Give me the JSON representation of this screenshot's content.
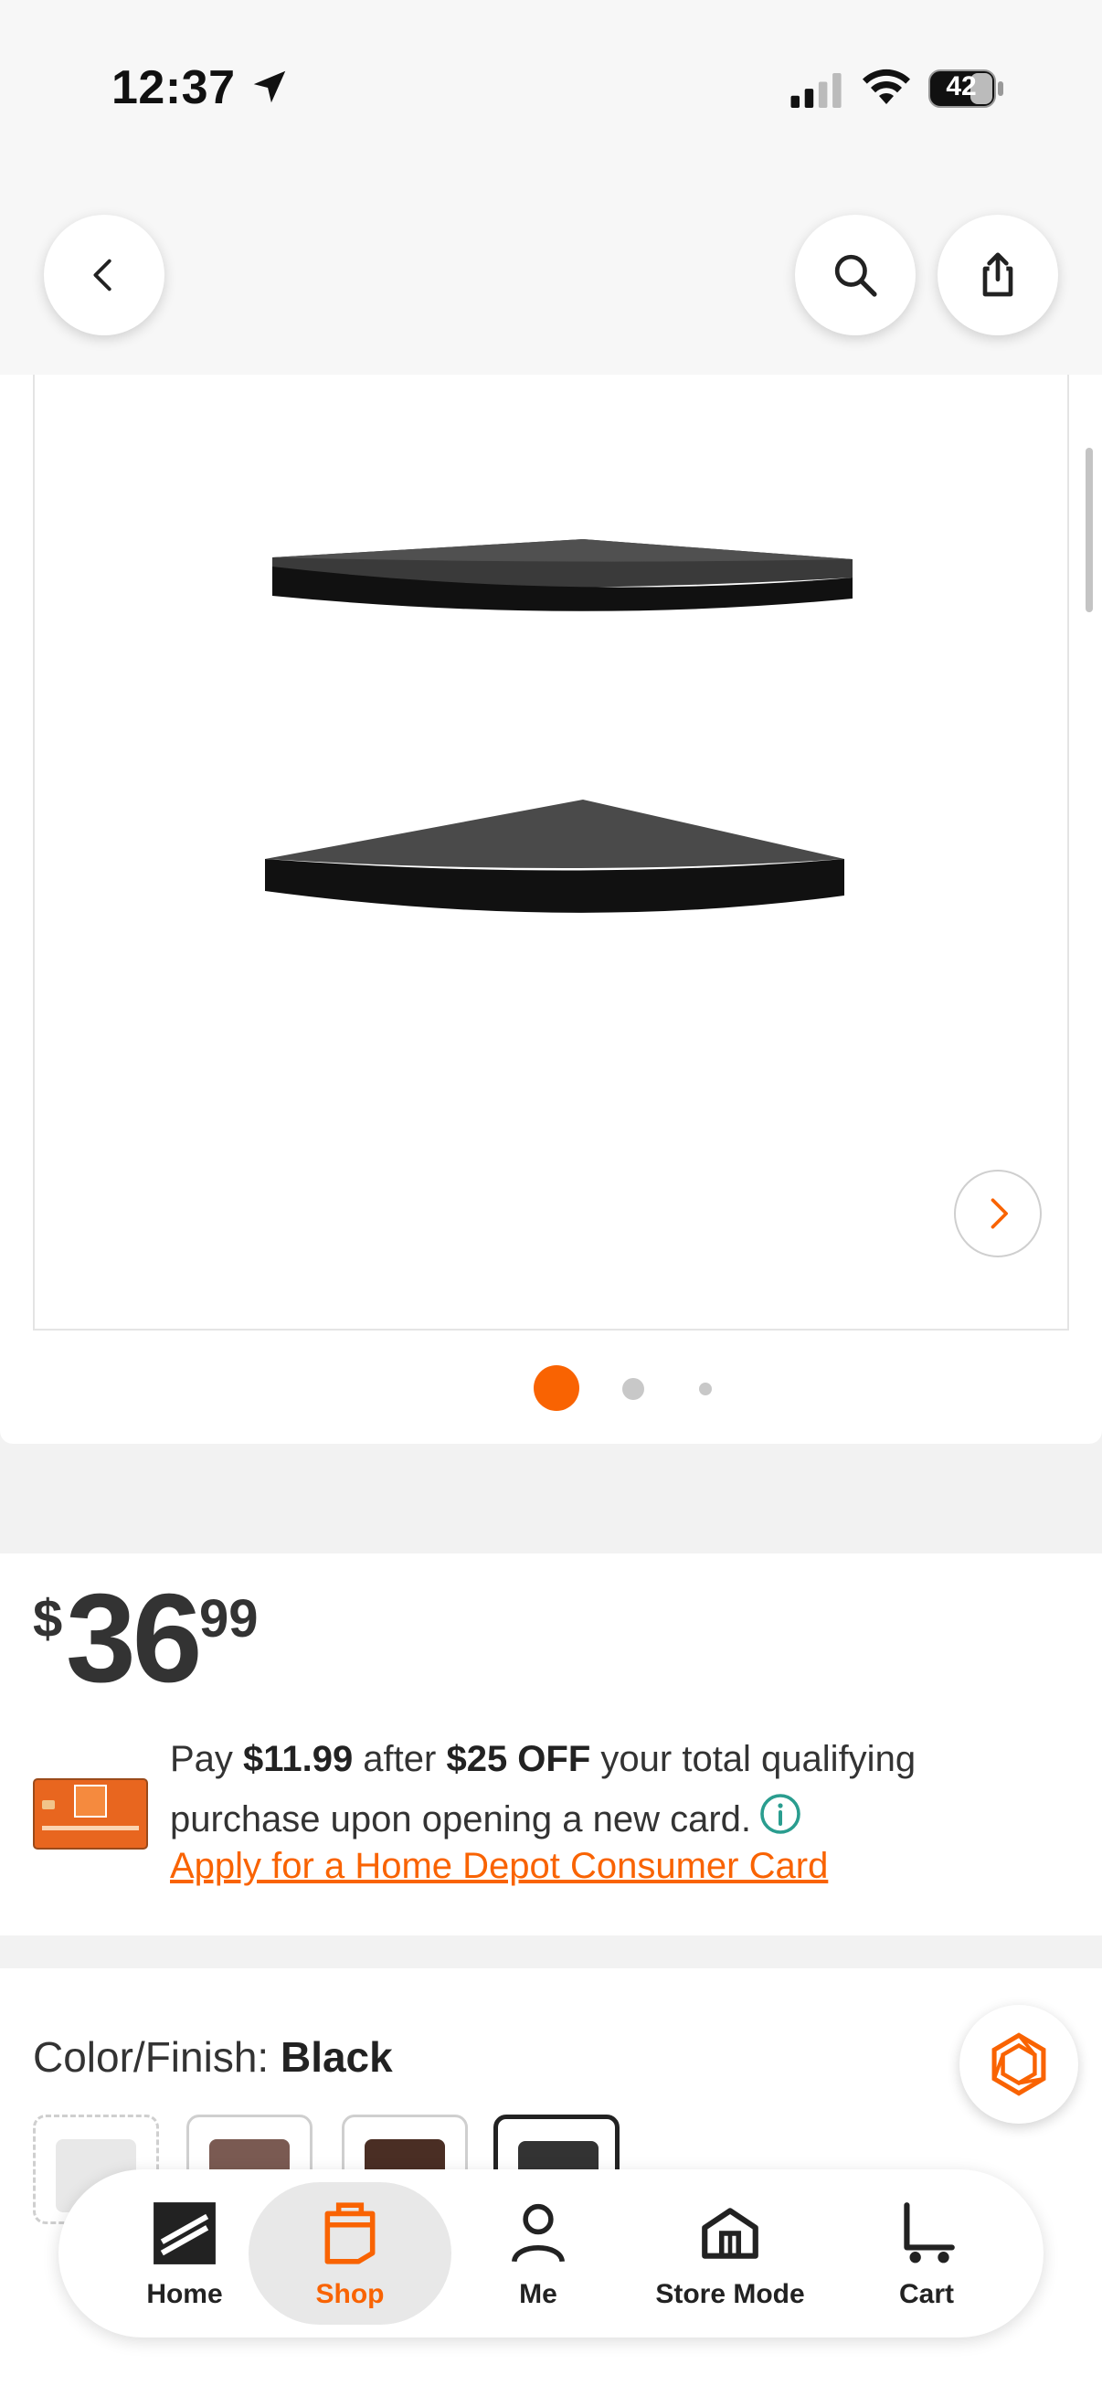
{
  "status_bar": {
    "time": "12:37",
    "battery": "42",
    "icons": [
      "location-arrow-icon",
      "cellular-signal-icon",
      "wifi-icon",
      "battery-icon"
    ]
  },
  "nav": {
    "icons": [
      "chevron-left-icon",
      "search-icon",
      "share-icon"
    ]
  },
  "gallery": {
    "image": "black corner floating shelves (2)",
    "dots_total": 3,
    "active_dot": 1,
    "icons": [
      "chevron-right-icon"
    ]
  },
  "price": {
    "currency": "$",
    "dollars": "36",
    "cents": "99"
  },
  "promo": {
    "pay_prefix": "Pay ",
    "pay_amount": "$11.99",
    "after": " after ",
    "discount": "$25 OFF",
    "suffix": " your total qualifying purchase upon opening a new card.",
    "link": "Apply for a Home Depot Consumer Card"
  },
  "color": {
    "label": "Color/Finish: ",
    "selected": "Black",
    "swatches": [
      {
        "name": "unavailable",
        "color": "#e8e8e8"
      },
      {
        "name": "brown",
        "color": "#7a5a52"
      },
      {
        "name": "espresso",
        "color": "#4a2e24"
      },
      {
        "name": "black",
        "color": "#333333"
      }
    ]
  },
  "tabs": {
    "home": "Home",
    "shop": "Shop",
    "me": "Me",
    "store_mode": "Store Mode",
    "cart": "Cart"
  },
  "colors": {
    "accent": "#f96302",
    "text": "#222222"
  }
}
